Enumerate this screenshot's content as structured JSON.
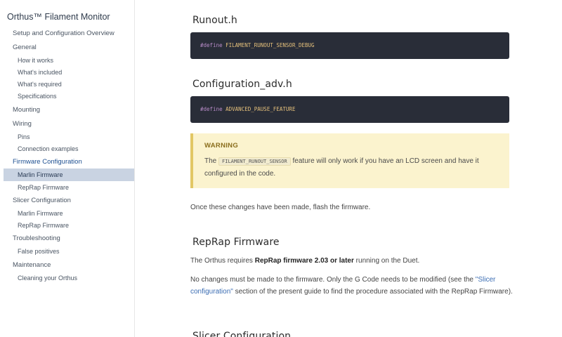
{
  "sidebar": {
    "title": "Orthus™ Filament Monitor",
    "items": [
      {
        "label": "Setup and Configuration Overview",
        "level": 1
      },
      {
        "label": "General",
        "level": 1
      },
      {
        "label": "How it works",
        "level": 2
      },
      {
        "label": "What's included",
        "level": 2
      },
      {
        "label": "What's required",
        "level": 2
      },
      {
        "label": "Specifications",
        "level": 2
      },
      {
        "label": "Mounting",
        "level": 1
      },
      {
        "label": "Wiring",
        "level": 1
      },
      {
        "label": "Pins",
        "level": 2
      },
      {
        "label": "Connection examples",
        "level": 2
      },
      {
        "label": "Firmware Configuration",
        "level": 1
      },
      {
        "label": "Marlin Firmware",
        "level": 2
      },
      {
        "label": "RepRap Firmware",
        "level": 2
      },
      {
        "label": "Slicer Configuration",
        "level": 1
      },
      {
        "label": "Marlin Firmware",
        "level": 2
      },
      {
        "label": "RepRap Firmware",
        "level": 2
      },
      {
        "label": "Troubleshooting",
        "level": 1
      },
      {
        "label": "False positives",
        "level": 2
      },
      {
        "label": "Maintenance",
        "level": 1
      },
      {
        "label": "Cleaning your Orthus",
        "level": 2
      }
    ]
  },
  "content": {
    "runout_heading": "Runout.h",
    "runout_code": {
      "keyword": "#define",
      "macro": "FILAMENT_RUNOUT_SENSOR_DEBUG"
    },
    "config_adv_heading": "Configuration_adv.h",
    "config_adv_code": {
      "keyword": "#define",
      "macro": "ADVANCED_PAUSE_FEATURE"
    },
    "warning": {
      "title": "WARNING",
      "text_before": "The",
      "code": "FILAMENT_RUNOUT_SENSOR",
      "text_after": "feature will only work if you have an LCD screen and have it configured in the code."
    },
    "flash_note": "Once these changes have been made, flash the firmware.",
    "reprap_heading": "RepRap Firmware",
    "reprap_p1": {
      "before": "The Orthus requires",
      "bold": "RepRap firmware 2.03 or later",
      "after": "running on the Duet."
    },
    "reprap_p2": {
      "before": "No changes must be made to the firmware. Only the G Code needs to be modified (see the",
      "link": "\"Slicer configuration\"",
      "after": "section of the present guide to find the procedure associated with the RepRap Firmware)."
    },
    "next_heading": "Slicer Configuration"
  }
}
